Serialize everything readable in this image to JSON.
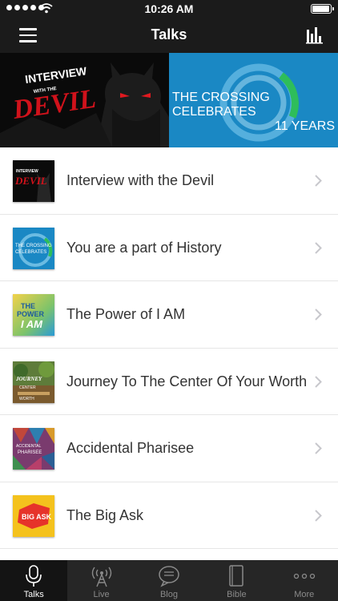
{
  "status_bar": {
    "time": "10:26 AM",
    "signal_bars": 5,
    "battery_level": 1.0
  },
  "navbar": {
    "title": "Talks",
    "menu_icon": "hamburger-icon",
    "right_icon": "bar-chart-icon"
  },
  "banner": {
    "left": {
      "line1": "INTERVIEW",
      "line2": "WITH THE",
      "line3": "DEVIL"
    },
    "right": {
      "line1": "THE CROSSING",
      "line2": "CELEBRATES",
      "line3": "11 YEARS"
    }
  },
  "talks": [
    {
      "title": "Interview with the Devil",
      "thumb_text": "DEVIL"
    },
    {
      "title": "You are a part of History",
      "thumb_text": "CELEBRATES"
    },
    {
      "title": "The Power of I AM",
      "thumb_text": "I AM"
    },
    {
      "title": "Journey To The Center Of Your Worth",
      "thumb_text": "JOURNEY"
    },
    {
      "title": "Accidental Pharisee",
      "thumb_text": "PHARISEE"
    },
    {
      "title": "The Big Ask",
      "thumb_text": "BIG ASK"
    }
  ],
  "tabbar": {
    "tabs": [
      {
        "label": "Talks",
        "icon": "microphone-icon"
      },
      {
        "label": "Live",
        "icon": "broadcast-tower-icon"
      },
      {
        "label": "Blog",
        "icon": "chat-bubble-icon"
      },
      {
        "label": "Bible",
        "icon": "book-icon"
      },
      {
        "label": "More",
        "icon": "more-dots-icon"
      }
    ],
    "active_index": 0
  },
  "colors": {
    "bar_bg": "#1b1b1b",
    "tab_bg": "#262626",
    "accent_blue": "#1a88c4",
    "devil_red": "#d0121b"
  }
}
